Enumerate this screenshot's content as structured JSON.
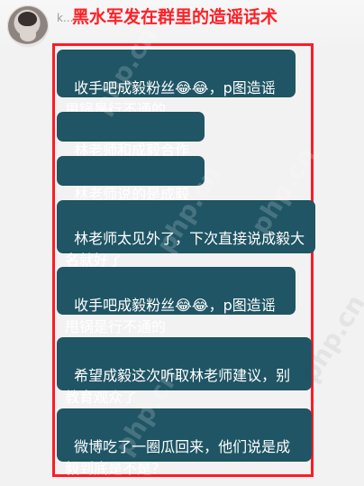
{
  "header": {
    "sender_mark": "k...",
    "headline": "黑水军发在群里的造谣话术"
  },
  "messages": [
    "收手吧成毅粉丝😂😂，p图造谣甩锅是行不通的",
    "林老师和成毅合作过",
    "林老师说的是成毅吧",
    "林老师太见外了，下次直接说成毅大名就好了",
    "收手吧成毅粉丝😂😂，p图造谣甩锅是行不通的",
    "希望成毅这次听取林老师建议，别教育观众了",
    "微博吃了一圈瓜回来，他们说是成毅到底是不是？"
  ],
  "watermarks": [
    "php.cn",
    "php.cn",
    "php.cn",
    "php.cn",
    "php.cn"
  ],
  "colors": {
    "bubble": "#1f5564",
    "headline": "#ff1f26",
    "frame": "#ff1b25",
    "background": "#f2f2f3"
  }
}
